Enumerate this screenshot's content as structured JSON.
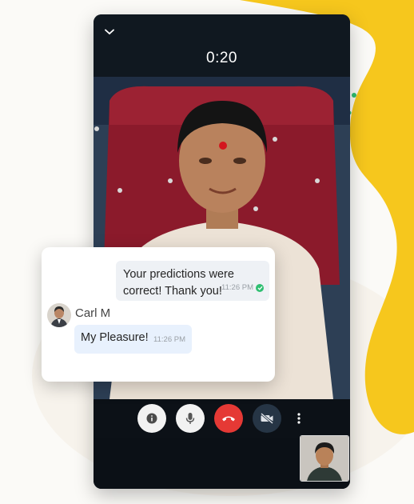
{
  "call": {
    "timer": "0:20",
    "controls": [
      "info",
      "microphone",
      "end-call",
      "camera-off",
      "more-options"
    ]
  },
  "chat": {
    "outgoing": {
      "text": "Your predictions were correct! Thank you!",
      "time": "11:26 PM",
      "status": "read"
    },
    "incoming": {
      "sender": "Carl M",
      "text": "My Pleasure!",
      "time": "11:26 PM"
    }
  },
  "colors": {
    "accent_yellow": "#f5c518",
    "end_call_red": "#e53935",
    "read_tick_green": "#2fbf71",
    "incoming_bubble": "#e8f1fd",
    "outgoing_bubble": "#eef1f5"
  },
  "icons": [
    "chevron-down-icon",
    "info-icon",
    "microphone-icon",
    "phone-hangup-icon",
    "camera-off-icon",
    "more-vertical-icon",
    "check-icon"
  ]
}
